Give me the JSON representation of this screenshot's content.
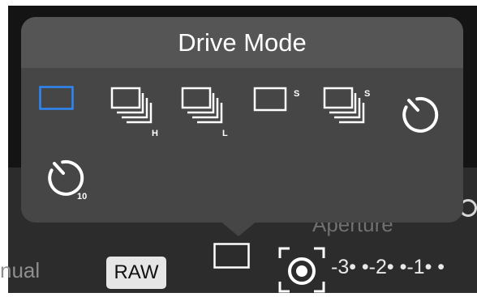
{
  "background": {
    "mode_label": "nual",
    "raw_badge": "RAW",
    "aperture_label": "Aperture",
    "exposure_scale": "-3• •-2• •-1• •"
  },
  "popup": {
    "title": "Drive Mode",
    "options": [
      {
        "icon": "single-frame-icon",
        "selected": true
      },
      {
        "icon": "continuous-high-icon",
        "badge": "H"
      },
      {
        "icon": "continuous-low-icon",
        "badge": "L"
      },
      {
        "icon": "single-silent-icon",
        "badge": "S"
      },
      {
        "icon": "continuous-silent-icon",
        "badge": "S"
      },
      {
        "icon": "self-timer-icon"
      },
      {
        "icon": "self-timer-10s-icon",
        "badge": "10"
      }
    ]
  },
  "colors": {
    "accent": "#2f86f6",
    "popup_bg": "#464646",
    "popup_header_bg": "#555555",
    "icon": "#ffffff"
  }
}
